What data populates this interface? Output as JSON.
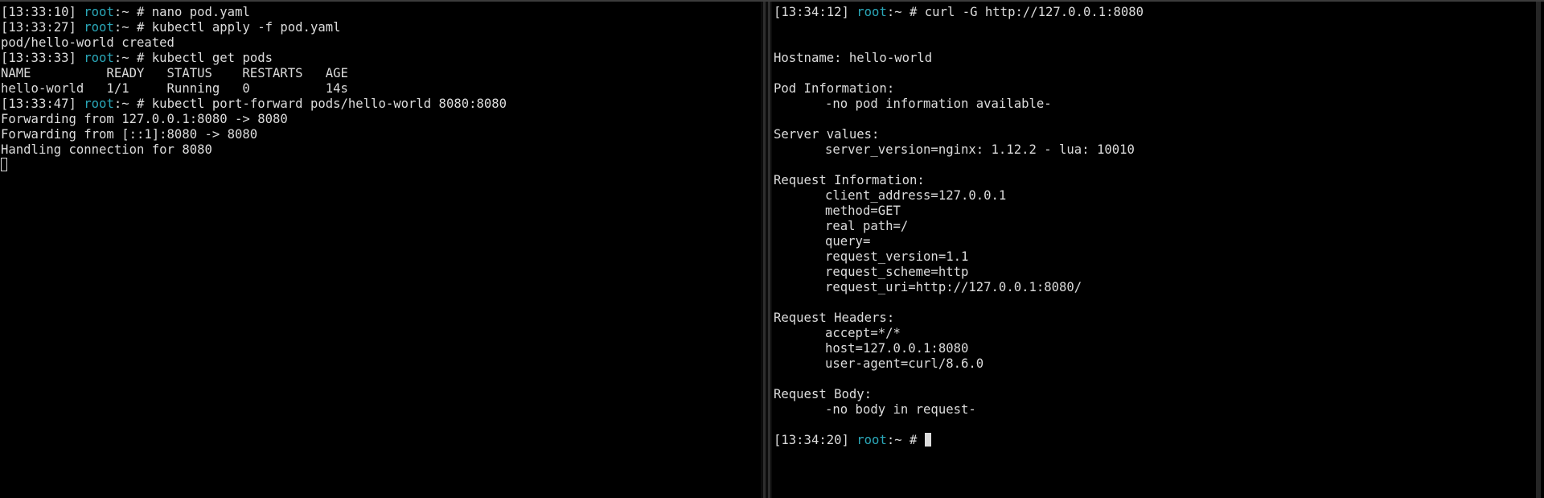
{
  "left_pane": {
    "lines": [
      {
        "ts": "[13:33:10]",
        "user": "root",
        "sep": ":~ # ",
        "cmd": "nano pod.yaml"
      },
      {
        "ts": "[13:33:27]",
        "user": "root",
        "sep": ":~ # ",
        "cmd": "kubectl apply -f pod.yaml"
      },
      {
        "out": "pod/hello-world created"
      },
      {
        "ts": "[13:33:33]",
        "user": "root",
        "sep": ":~ # ",
        "cmd": "kubectl get pods"
      },
      {
        "out": "NAME          READY   STATUS    RESTARTS   AGE"
      },
      {
        "out": "hello-world   1/1     Running   0          14s"
      },
      {
        "ts": "[13:33:47]",
        "user": "root",
        "sep": ":~ # ",
        "cmd": "kubectl port-forward pods/hello-world 8080:8080"
      },
      {
        "out": "Forwarding from 127.0.0.1:8080 -> 8080"
      },
      {
        "out": "Forwarding from [::1]:8080 -> 8080"
      },
      {
        "out": "Handling connection for 8080"
      }
    ]
  },
  "right_pane": {
    "prompt1": {
      "ts": "[13:34:12]",
      "user": "root",
      "sep": ":~ # ",
      "cmd": "curl -G http://127.0.0.1:8080"
    },
    "hostname": "Hostname: hello-world",
    "pod_info_header": "Pod Information:",
    "pod_info_value": "-no pod information available-",
    "server_values_header": "Server values:",
    "server_version": "server_version=nginx: 1.12.2 - lua: 10010",
    "request_info_header": "Request Information:",
    "request_info": [
      "client_address=127.0.0.1",
      "method=GET",
      "real path=/",
      "query=",
      "request_version=1.1",
      "request_scheme=http",
      "request_uri=http://127.0.0.1:8080/"
    ],
    "request_headers_header": "Request Headers:",
    "request_headers": [
      "accept=*/*",
      "host=127.0.0.1:8080",
      "user-agent=curl/8.6.0"
    ],
    "request_body_header": "Request Body:",
    "request_body_value": "-no body in request-",
    "prompt2": {
      "ts": "[13:34:20]",
      "user": "root",
      "sep": ":~ # "
    }
  },
  "colors": {
    "background": "#000000",
    "text": "#dcdcdc",
    "user": "#2aa7b8"
  }
}
